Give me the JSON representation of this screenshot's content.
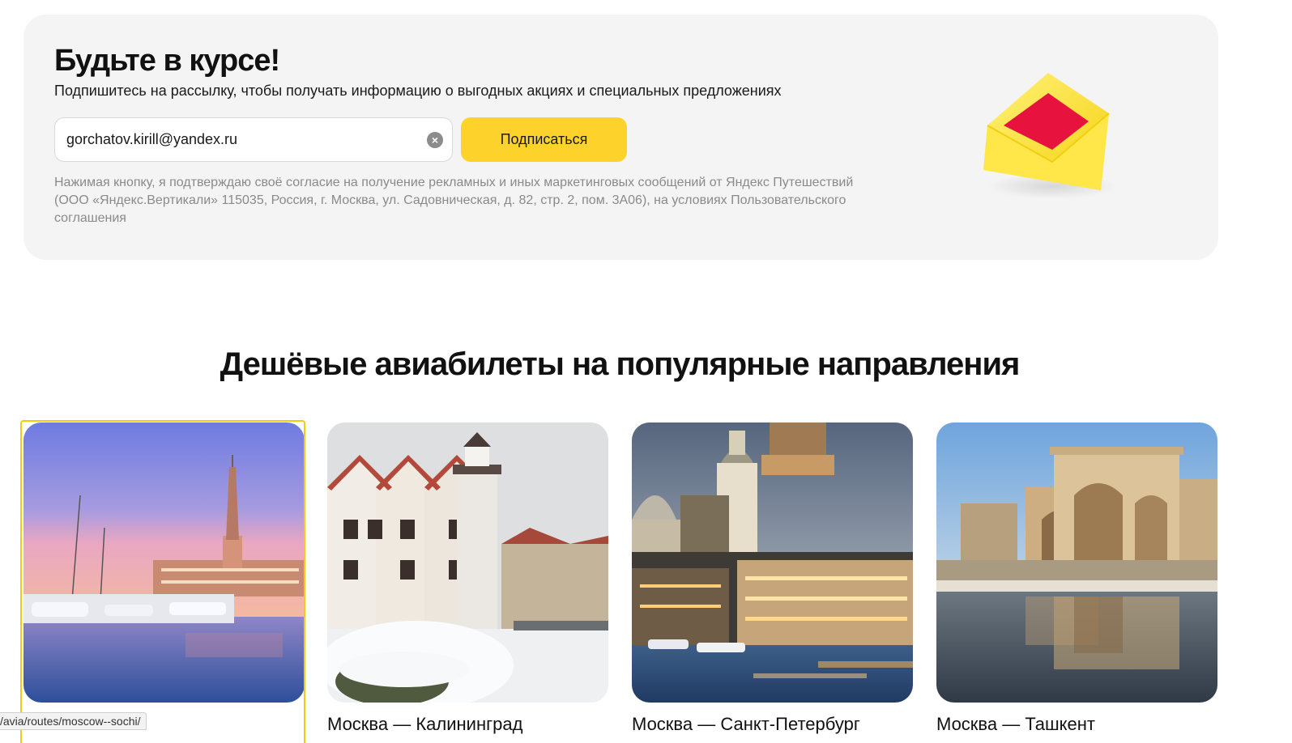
{
  "subscribe": {
    "title": "Будьте в курсе!",
    "description": "Подпишитесь на рассылку, чтобы получать информацию о выгодных акциях и специальных предложениях",
    "email_value": "gorchatov.kirill@yandex.ru",
    "button_label": "Подписаться",
    "disclaimer": "Нажимая кнопку, я подтверждаю своё согласие на получение рекламных и иных маркетинговых сообщений от Яндекс Путешествий (ООО «Яндекс.Вертикали» 115035, Россия, г. Москва, ул. Садовническая, д. 82, стр. 2, пом. 3А06), на условиях Пользовательского соглашения",
    "clear_icon": "clear-icon",
    "illustration": "envelope-icon"
  },
  "popular": {
    "title": "Дешёвые авиабилеты на популярные направления",
    "cards": [
      {
        "caption": "",
        "image": "sochi-sea-port"
      },
      {
        "caption": "Москва — Калининград",
        "image": "kaliningrad-fishing-village"
      },
      {
        "caption": "Москва — Санкт-Петербург",
        "image": "saint-petersburg-embankment"
      },
      {
        "caption": "Москва — Ташкент",
        "image": "uzbekistan-madrasah"
      }
    ]
  },
  "status_bar": {
    "url": "/avia/routes/moscow--sochi/"
  },
  "colors": {
    "accent": "#fdd32b",
    "panel": "#f4f4f4",
    "focus": "#f6c915"
  }
}
